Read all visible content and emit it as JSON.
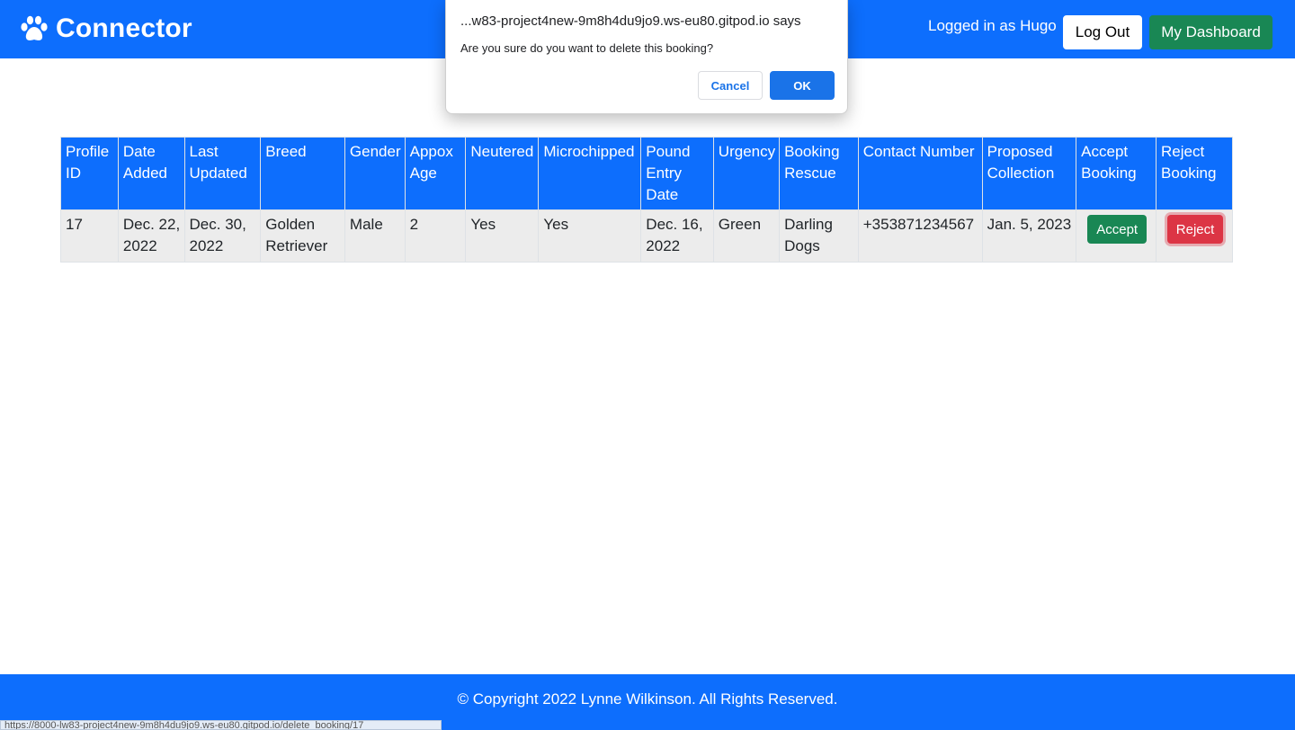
{
  "navbar": {
    "brand": "Connector",
    "brand_icon": "paw-icon",
    "logged_in_text": "Logged in as Hugo",
    "logout_label": "Log Out",
    "dashboard_label": "My Dashboard"
  },
  "table": {
    "headers": [
      "Profile ID",
      "Date Added",
      "Last Updated",
      "Breed",
      "Gender",
      "Appox Age",
      "Neutered",
      "Microchipped",
      "Pound Entry Date",
      "Urgency",
      "Booking Rescue",
      "Contact Number",
      "Proposed Collection",
      "Accept Booking",
      "Reject Booking"
    ],
    "rows": [
      {
        "profile_id": "17",
        "date_added": "Dec. 22, 2022",
        "last_updated": "Dec. 30, 2022",
        "breed": "Golden Retriever",
        "gender": "Male",
        "age": "2",
        "neutered": "Yes",
        "microchipped": "Yes",
        "pound_entry_date": "Dec. 16, 2022",
        "urgency": "Green",
        "booking_rescue": "Darling Dogs",
        "contact_number": "+353871234567",
        "proposed_collection": "Jan. 5, 2023",
        "accept_label": "Accept",
        "reject_label": "Reject"
      }
    ]
  },
  "footer": {
    "text": "© Copyright 2022 Lynne Wilkinson. All Rights Reserved."
  },
  "status_bar": {
    "url": "https://8000-lw83-project4new-9m8h4du9jo9.ws-eu80.gitpod.io/delete_booking/17"
  },
  "dialog": {
    "title": "...w83-project4new-9m8h4du9jo9.ws-eu80.gitpod.io says",
    "message": "Are you sure do you want to delete this booking?",
    "cancel_label": "Cancel",
    "ok_label": "OK"
  },
  "colors": {
    "primary": "#0d6efd",
    "success": "#198754",
    "danger": "#dc3545",
    "dialog_accent": "#1a73e8"
  }
}
